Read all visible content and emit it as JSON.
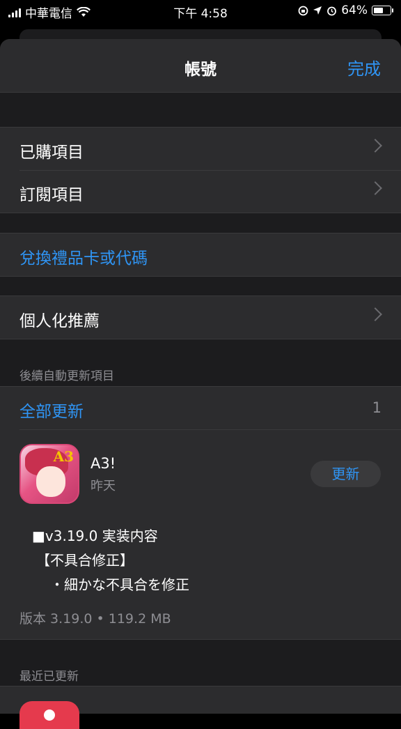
{
  "status_bar": {
    "carrier": "中華電信",
    "time": "下午 4:58",
    "battery": "64%",
    "battery_level": 0.64
  },
  "nav": {
    "title": "帳號",
    "done": "完成"
  },
  "account_rows": [
    {
      "label": "已購項目"
    },
    {
      "label": "訂閱項目"
    }
  ],
  "redeem": {
    "label": "兌換禮品卡或代碼"
  },
  "personalized": {
    "label": "個人化推薦"
  },
  "pending_updates": {
    "header": "後續自動更新項目",
    "update_all": "全部更新",
    "count": "1",
    "app": {
      "name": "A3!",
      "date": "昨天",
      "badge": "A3",
      "button": "更新",
      "notes": [
        "■v3.19.0 実装内容",
        "【不具合修正】",
        "・細かな不具合を修正"
      ],
      "version_info": "版本 3.19.0 • 119.2 MB"
    }
  },
  "recent": {
    "header": "最近已更新"
  }
}
